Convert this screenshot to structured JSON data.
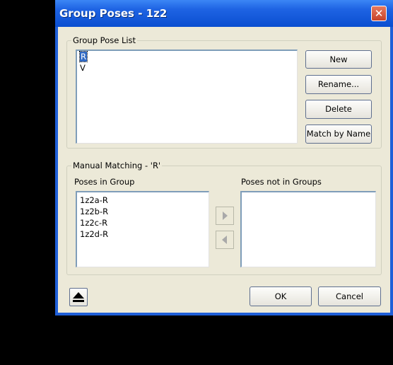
{
  "window": {
    "title": "Group Poses - 1z2",
    "close_glyph": "✕"
  },
  "group_pose_list": {
    "legend": "Group Pose List",
    "items": [
      "R",
      "V"
    ],
    "selected_index": 0,
    "buttons": {
      "new": "New",
      "rename": "Rename...",
      "delete": "Delete",
      "match_by_name": "Match by Name"
    }
  },
  "manual_matching": {
    "legend": "Manual Matching  - 'R'",
    "poses_in_group_label": "Poses in Group",
    "poses_in_group": [
      "1z2a-R",
      "1z2b-R",
      "1z2c-R",
      "1z2d-R"
    ],
    "poses_not_in_groups_label": "Poses not in Groups",
    "poses_not_in_groups": [],
    "move_right_icon": "arrow-right-icon",
    "move_left_icon": "arrow-left-icon"
  },
  "footer": {
    "collapse_icon": "eject-up-icon",
    "ok": "OK",
    "cancel": "Cancel"
  }
}
